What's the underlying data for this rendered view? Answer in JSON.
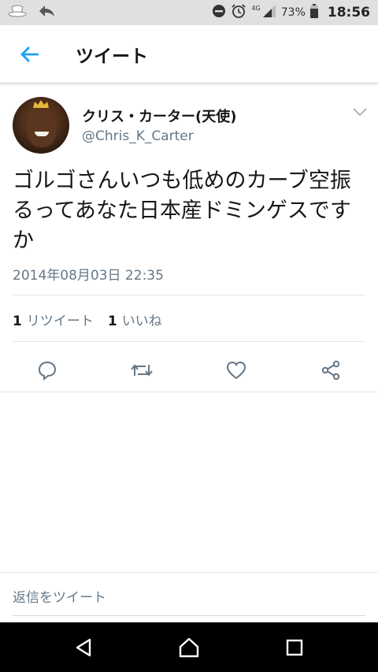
{
  "status_bar": {
    "network": "4G",
    "battery": "73%",
    "time": "18:56"
  },
  "app_bar": {
    "title": "ツイート"
  },
  "tweet": {
    "author_name": "クリス・カーター(天使)",
    "author_handle": "@Chris_K_Carter",
    "text": "ゴルゴさんいつも低めのカーブ空振るってあなた日本産ドミンゲスですか",
    "timestamp": "2014年08月03日 22:35",
    "retweet_count": "1",
    "retweet_label": "リツイート",
    "like_count": "1",
    "like_label": "いいね"
  },
  "reply": {
    "placeholder": "返信をツイート"
  },
  "colors": {
    "accent": "#1da1f2",
    "secondary_text": "#657786",
    "divider": "#e1e8ed",
    "statusbar_bg": "#e0e0e0",
    "navbar_bg": "#000000"
  }
}
